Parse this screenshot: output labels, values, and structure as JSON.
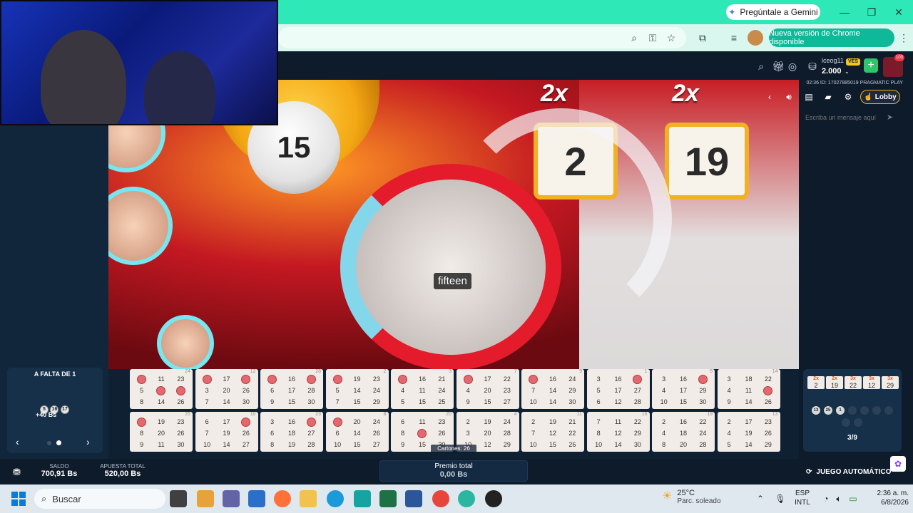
{
  "browser": {
    "gemini_label": "Pregúntale a Gemini",
    "update_label": "Nueva versión de Chrome disponible"
  },
  "header": {
    "username": "lceog11",
    "currency_badge": "VES",
    "balance": "2.000",
    "avatar_badge": "103"
  },
  "stream": {
    "info": "02:36 ID: 17027885019 PRAGMATIC PLAY",
    "caption": "fifteen",
    "current_ball": "15",
    "sign_left": "2",
    "sign_right": "19",
    "multiplier_left": "2x",
    "multiplier_right": "2x"
  },
  "controls": {
    "lobby_label": "Lobby",
    "chat_placeholder": "Escriba un mensaje aquí"
  },
  "falta": {
    "title": "A FALTA DE 1",
    "balls": [
      "5",
      "16",
      "17"
    ],
    "prize": "+40 Bs"
  },
  "cards_label": "Cartones: 26",
  "cards": [
    {
      "id": "24",
      "nums": [
        "",
        "11",
        "23",
        "5",
        "",
        "",
        "8",
        "14",
        "26"
      ],
      "marked": [
        0,
        4,
        5
      ]
    },
    {
      "id": "12",
      "nums": [
        "",
        "17",
        "",
        "3",
        "20",
        "26",
        "7",
        "14",
        "30"
      ],
      "marked": [
        0,
        2
      ]
    },
    {
      "id": "28",
      "nums": [
        "",
        "16",
        "",
        "6",
        "17",
        "28",
        "9",
        "15",
        "30"
      ],
      "marked": [
        0,
        2
      ]
    },
    {
      "id": "2",
      "nums": [
        "",
        "19",
        "23",
        "5",
        "14",
        "24",
        "7",
        "15",
        "29"
      ],
      "marked": [
        0
      ]
    },
    {
      "id": "3",
      "nums": [
        "",
        "16",
        "21",
        "4",
        "11",
        "24",
        "5",
        "15",
        "25"
      ],
      "marked": [
        0
      ]
    },
    {
      "id": "7",
      "nums": [
        "",
        "17",
        "22",
        "4",
        "20",
        "23",
        "9",
        "15",
        "27"
      ],
      "marked": [
        0
      ]
    },
    {
      "id": "9",
      "nums": [
        "",
        "16",
        "24",
        "7",
        "14",
        "29",
        "10",
        "14",
        "30"
      ],
      "marked": [
        0
      ]
    },
    {
      "id": "1",
      "nums": [
        "3",
        "16",
        "",
        "5",
        "17",
        "27",
        "6",
        "12",
        "28"
      ],
      "marked": [
        2
      ]
    },
    {
      "id": "5",
      "nums": [
        "3",
        "16",
        "",
        "4",
        "17",
        "29",
        "10",
        "15",
        "30"
      ],
      "marked": [
        2
      ]
    },
    {
      "id": "14",
      "nums": [
        "3",
        "18",
        "22",
        "4",
        "11",
        "",
        "9",
        "14",
        "26"
      ],
      "marked": [
        5
      ]
    },
    {
      "id": "25",
      "nums": [
        "",
        "19",
        "23",
        "8",
        "20",
        "26",
        "9",
        "11",
        "30"
      ],
      "marked": [
        0
      ]
    },
    {
      "id": "10",
      "nums": [
        "6",
        "17",
        "",
        "7",
        "19",
        "26",
        "10",
        "14",
        "27"
      ],
      "marked": [
        2
      ]
    },
    {
      "id": "23",
      "nums": [
        "3",
        "16",
        "",
        "6",
        "18",
        "27",
        "8",
        "19",
        "28"
      ],
      "marked": [
        2
      ]
    },
    {
      "id": "8",
      "nums": [
        "",
        "20",
        "24",
        "6",
        "14",
        "26",
        "10",
        "15",
        "27"
      ],
      "marked": [
        0
      ]
    },
    {
      "id": "20",
      "nums": [
        "6",
        "11",
        "23",
        "8",
        "",
        "26",
        "9",
        "15",
        "30"
      ],
      "marked": [
        4
      ]
    },
    {
      "id": "4",
      "nums": [
        "2",
        "19",
        "24",
        "3",
        "20",
        "28",
        "10",
        "12",
        "29"
      ],
      "marked": []
    },
    {
      "id": "11",
      "nums": [
        "2",
        "19",
        "21",
        "7",
        "12",
        "22",
        "10",
        "15",
        "26"
      ],
      "marked": []
    },
    {
      "id": "16",
      "nums": [
        "7",
        "11",
        "22",
        "8",
        "12",
        "29",
        "10",
        "14",
        "30"
      ],
      "marked": []
    },
    {
      "id": "19",
      "nums": [
        "2",
        "16",
        "22",
        "4",
        "18",
        "24",
        "8",
        "20",
        "28"
      ],
      "marked": []
    },
    {
      "id": "13",
      "nums": [
        "2",
        "17",
        "23",
        "4",
        "19",
        "26",
        "5",
        "14",
        "29"
      ],
      "marked": []
    }
  ],
  "multipliers": [
    {
      "x": "2x",
      "v": "2"
    },
    {
      "x": "2x",
      "v": "19"
    },
    {
      "x": "3x",
      "v": "22"
    },
    {
      "x": "3x",
      "v": "12"
    },
    {
      "x": "3x",
      "v": "29"
    }
  ],
  "drawn_balls": [
    "13",
    "25",
    "1"
  ],
  "progress": "3/9",
  "bottom": {
    "saldo_label": "SALDO",
    "saldo_value": "700,91 Bs",
    "apuesta_label": "APUESTA TOTAL",
    "apuesta_value": "520,00 Bs",
    "premio_label": "Premio total",
    "premio_value": "0,00 Bs",
    "auto_label": "JUEGO AUTOMÁTICO"
  },
  "taskbar": {
    "search_label": "Buscar",
    "temp": "25°C",
    "weather": "Parc. soleado",
    "lang1": "ESP",
    "lang2": "INTL",
    "time": "2:36 a. m.",
    "date": "6/8/2026"
  },
  "colors": {
    "tabbar": "#2ee8b8",
    "update_button": "#10b89a",
    "marked": "#e36970",
    "lobby_border": "#f2b023"
  }
}
